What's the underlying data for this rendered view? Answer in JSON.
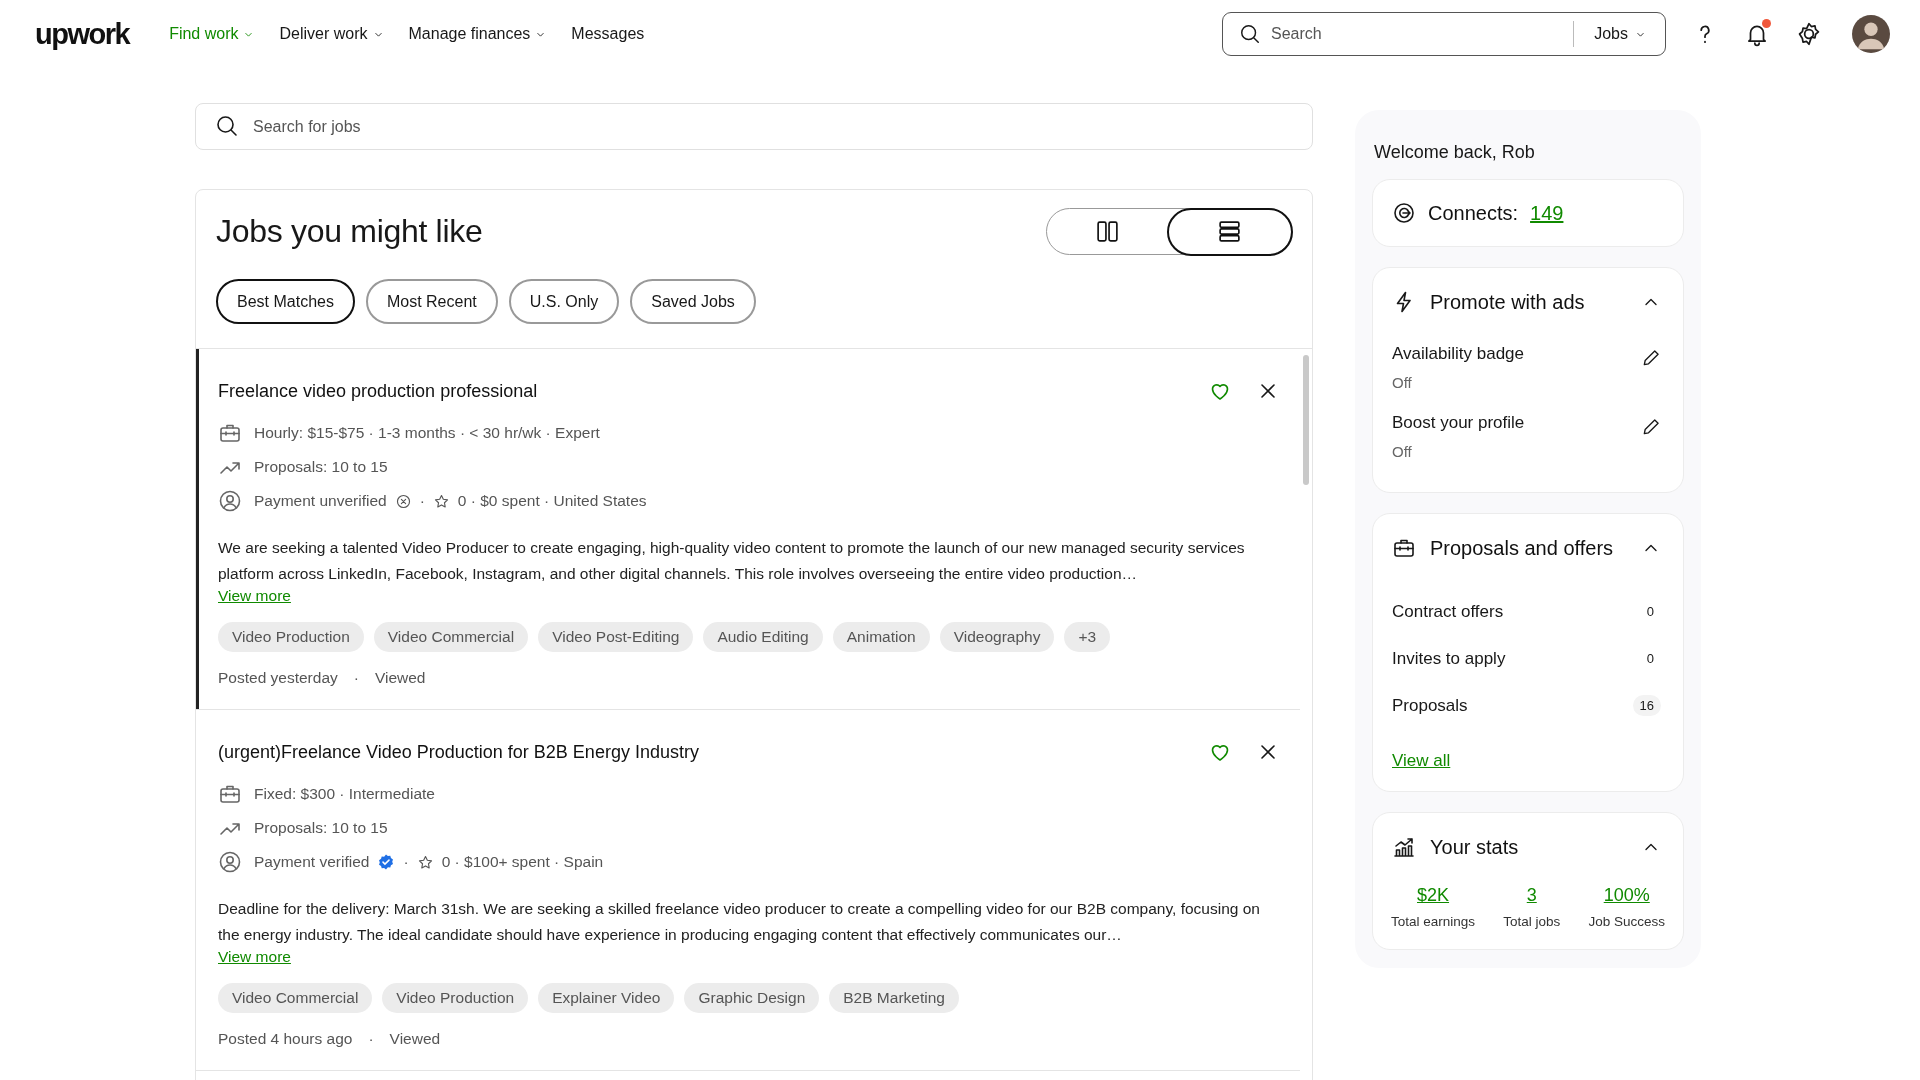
{
  "nav": {
    "logo": "upwork",
    "items": [
      {
        "label": "Find work",
        "selected": true,
        "dropdown": true
      },
      {
        "label": "Deliver work",
        "selected": false,
        "dropdown": true
      },
      {
        "label": "Manage finances",
        "selected": false,
        "dropdown": true
      },
      {
        "label": "Messages",
        "selected": false,
        "dropdown": false
      }
    ],
    "search": {
      "placeholder": "Search",
      "scope": "Jobs"
    },
    "has_notification": true
  },
  "job_search": {
    "placeholder": "Search for jobs"
  },
  "feed": {
    "title": "Jobs you might like",
    "views": [
      {
        "kind": "columns",
        "selected": false
      },
      {
        "kind": "list",
        "selected": true
      }
    ],
    "filters": [
      {
        "label": "Best Matches",
        "selected": true
      },
      {
        "label": "Most Recent",
        "selected": false
      },
      {
        "label": "U.S. Only",
        "selected": false
      },
      {
        "label": "Saved Jobs",
        "selected": false
      }
    ],
    "jobs": [
      {
        "title": "Freelance video production professional",
        "selected": true,
        "budget": "Hourly: $15-$75 · 1-3 months · < 30 hr/wk · Expert",
        "proposals": "Proposals: 10 to 15",
        "payment": "Payment unverified",
        "verified": false,
        "dot": "·",
        "client_info": "0 · $0 spent · United States",
        "description": "We are seeking a talented Video Producer to create engaging, high-quality video content to promote the launch of our new managed security services platform across LinkedIn, Facebook, Instagram, and other digital channels. This role involves overseeing the entire video production…",
        "view_more": "View more",
        "tags": [
          "Video Production",
          "Video Commercial",
          "Video Post-Editing",
          "Audio Editing",
          "Animation",
          "Videography",
          "+3"
        ],
        "footer": [
          "Posted yesterday",
          "·",
          "Viewed"
        ]
      },
      {
        "title": "(urgent)Freelance Video Production for B2B Energy Industry",
        "selected": false,
        "budget": "Fixed: $300 · Intermediate",
        "proposals": "Proposals: 10 to 15",
        "payment": "Payment verified",
        "verified": true,
        "dot": "·",
        "client_info": "0 · $100+ spent · Spain",
        "description": "Deadline for the delivery: March 31sh. We are seeking a skilled freelance video producer to create a compelling video for our B2B company, focusing on the energy industry. The ideal candidate should have experience in producing engaging content that effectively communicates our…",
        "view_more": "View more",
        "tags": [
          "Video Commercial",
          "Video Production",
          "Explainer Video",
          "Graphic Design",
          "B2B Marketing"
        ],
        "footer": [
          "Posted 4 hours ago",
          "·",
          "Viewed"
        ]
      }
    ]
  },
  "sidebar": {
    "welcome": "Welcome back, Rob",
    "connects": {
      "label": "Connects:",
      "value": "149"
    },
    "sections": [
      {
        "kind": "promote",
        "title": "Promote with ads",
        "expanded": true,
        "items": [
          {
            "name": "Availability badge",
            "status": "Off"
          },
          {
            "name": "Boost your profile",
            "status": "Off"
          }
        ]
      },
      {
        "kind": "proposals",
        "title": "Proposals and offers",
        "expanded": true,
        "rows": [
          {
            "label": "Contract offers",
            "count": "0",
            "highlight": false
          },
          {
            "label": "Invites to apply",
            "count": "0",
            "highlight": false
          },
          {
            "label": "Proposals",
            "count": "16",
            "highlight": true
          }
        ],
        "link": "View all"
      },
      {
        "kind": "stats",
        "title": "Your stats",
        "expanded": true,
        "stats": [
          {
            "value": "$2K",
            "label": "Total earnings"
          },
          {
            "value": "3",
            "label": "Total jobs"
          },
          {
            "value": "100%",
            "label": "Job Success"
          }
        ]
      }
    ]
  }
}
